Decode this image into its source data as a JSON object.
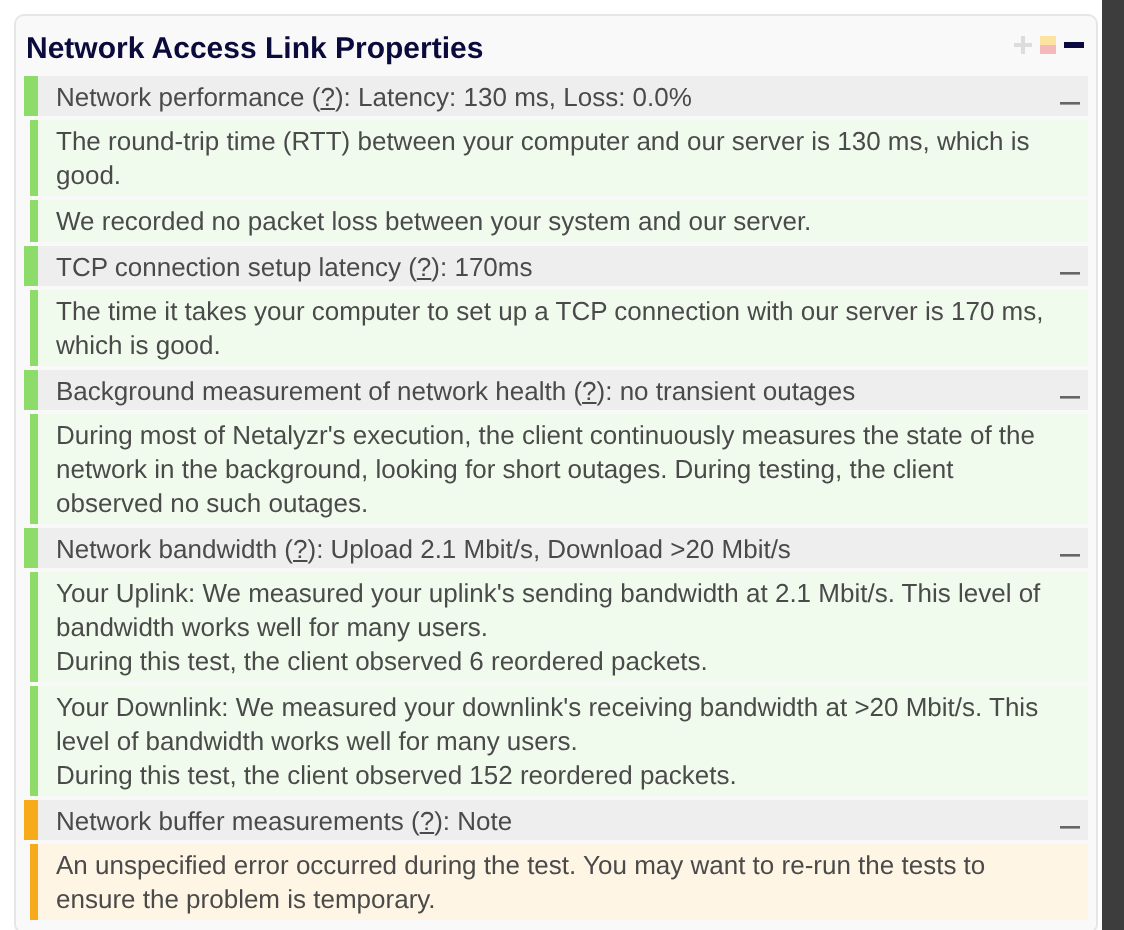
{
  "panel": {
    "title": "Network Access Link Properties"
  },
  "sections": [
    {
      "color": "#8ddc6a",
      "label": "Network performance (",
      "help": "?",
      "value": "): Latency: 130 ms, Loss: 0.0%",
      "expanded": true,
      "paragraphs": [
        [
          "The round-trip time (RTT) between your computer and our server is 130 ms, which is good."
        ],
        [
          "We recorded no packet loss between your system and our server."
        ]
      ]
    },
    {
      "color": "#8ddc6a",
      "label": "TCP connection setup latency (",
      "help": "?",
      "value": "): 170ms",
      "expanded": true,
      "paragraphs": [
        [
          "The time it takes your computer to set up a TCP connection with our server is 170 ms, which is good."
        ]
      ]
    },
    {
      "color": "#8ddc6a",
      "label": "Background measurement of network health (",
      "help": "?",
      "value": "): no transient outages",
      "expanded": true,
      "paragraphs": [
        [
          "During most of Netalyzr's execution, the client continuously measures the state of the network in the background, looking for short outages. During testing, the client observed no such outages."
        ]
      ]
    },
    {
      "color": "#8ddc6a",
      "label": "Network bandwidth (",
      "help": "?",
      "value": "): Upload 2.1 Mbit/s, Download >20 Mbit/s",
      "expanded": true,
      "paragraphs": [
        [
          "Your Uplink: We measured your uplink's sending bandwidth at 2.1 Mbit/s. This level of bandwidth works well for many users.",
          "During this test, the client observed 6 reordered packets."
        ],
        [
          "Your Downlink: We measured your downlink's receiving bandwidth at >20 Mbit/s. This level of bandwidth works well for many users.",
          "During this test, the client observed 152 reordered packets."
        ]
      ]
    },
    {
      "color": "#f7ab1a",
      "label": "Network buffer measurements (",
      "help": "?",
      "value": "): Note",
      "expanded": true,
      "paragraphs": [
        [
          "An unspecified error occurred during the test. You may want to re-run the tests to ensure the problem is temporary."
        ]
      ]
    }
  ]
}
